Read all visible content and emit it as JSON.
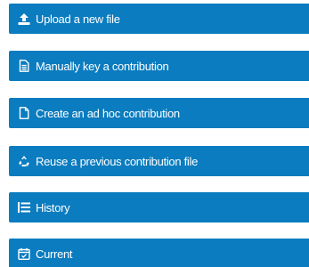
{
  "accent_color": "#0a7cbf",
  "menu": {
    "items": [
      {
        "label": "Upload a new file",
        "icon": "upload-icon"
      },
      {
        "label": "Manually key a contribution",
        "icon": "document-icon"
      },
      {
        "label": "Create an ad hoc contribution",
        "icon": "new-file-icon"
      },
      {
        "label": "Reuse a previous contribution file",
        "icon": "recycle-icon"
      },
      {
        "label": "History",
        "icon": "list-icon"
      },
      {
        "label": "Current",
        "icon": "calendar-icon"
      }
    ]
  }
}
